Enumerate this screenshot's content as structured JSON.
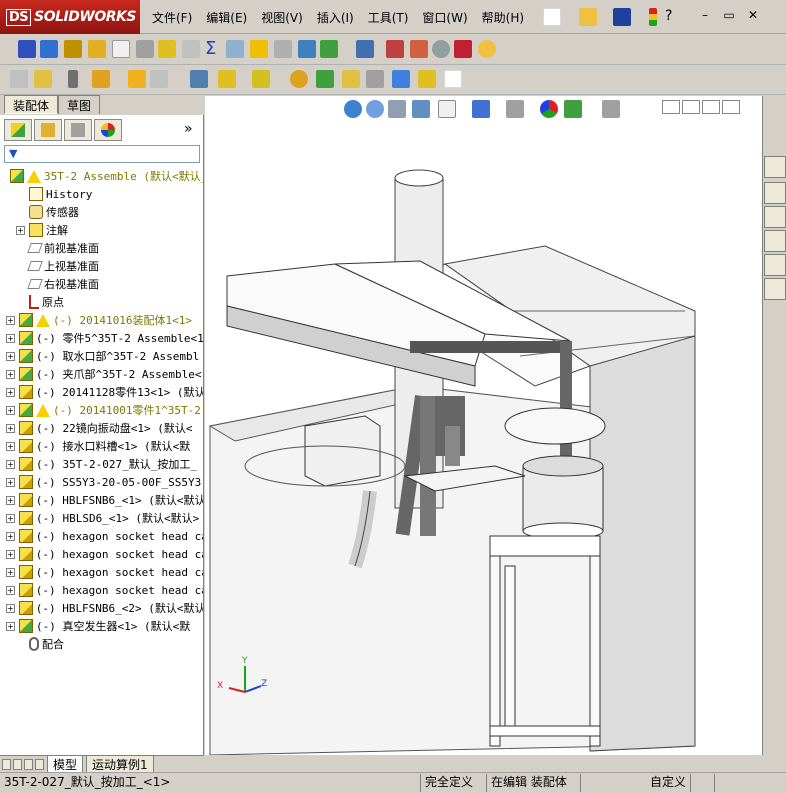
{
  "app": {
    "brand": "SOLIDWORKS",
    "brand_prefix": "DS"
  },
  "menu": [
    "文件(F)",
    "编辑(E)",
    "视图(V)",
    "插入(I)",
    "工具(T)",
    "窗口(W)",
    "帮助(H)"
  ],
  "window_controls": {
    "minimize": "–",
    "restore": "▭",
    "close": "✕"
  },
  "command_tabs": [
    {
      "label": "装配体",
      "active": true
    },
    {
      "label": "草图",
      "active": false
    }
  ],
  "filter": {
    "glyph": "▼"
  },
  "pane_collapse": "»",
  "tree": [
    {
      "label": "35T-2 Assemble  (默认<默认_",
      "icon": "assy",
      "warn": true,
      "exp": false,
      "level": 0,
      "olive": true
    },
    {
      "label": "History",
      "icon": "history",
      "level": 1
    },
    {
      "label": "传感器",
      "icon": "sensor",
      "level": 1
    },
    {
      "label": "注解",
      "icon": "annot",
      "level": 1,
      "exp": true
    },
    {
      "label": "前视基准面",
      "icon": "plane",
      "level": 1
    },
    {
      "label": "上视基准面",
      "icon": "plane",
      "level": 1
    },
    {
      "label": "右视基准面",
      "icon": "plane",
      "level": 1
    },
    {
      "label": "原点",
      "icon": "origin",
      "level": 1
    },
    {
      "label": "(-) 20141016装配体1<1>",
      "icon": "assy",
      "warn": true,
      "exp": true,
      "olive": true
    },
    {
      "label": "(-) 零件5^35T-2 Assemble<1",
      "icon": "assy",
      "exp": true
    },
    {
      "label": "(-) 取水口部^35T-2 Assembl",
      "icon": "assy",
      "exp": true
    },
    {
      "label": "(-) 夹爪部^35T-2 Assemble<",
      "icon": "assy",
      "exp": true
    },
    {
      "label": "(-) 20141128零件13<1> (默认",
      "icon": "part",
      "exp": true
    },
    {
      "label": "(-) 20141001零件1^35T-2",
      "icon": "assy",
      "warn": true,
      "exp": true,
      "olive": true
    },
    {
      "label": "(-) 22镜向振动盘<1> (默认<",
      "icon": "part",
      "exp": true
    },
    {
      "label": "(-) 接水口料槽<1> (默认<默",
      "icon": "part",
      "exp": true
    },
    {
      "label": "(-) 35T-2-027_默认_按加工_",
      "icon": "part",
      "exp": true
    },
    {
      "label": "(-) SS5Y3-20-05-00F_SS5Y3-2",
      "icon": "part",
      "exp": true
    },
    {
      "label": "(-) HBLFSNB6_<1> (默认<默认",
      "icon": "part",
      "exp": true
    },
    {
      "label": "(-) HBLSD6_<1> (默认<默认>",
      "icon": "part",
      "exp": true
    },
    {
      "label": "(-) hexagon socket head cap",
      "icon": "part",
      "exp": true
    },
    {
      "label": "(-) hexagon socket head cap",
      "icon": "part",
      "exp": true
    },
    {
      "label": "(-) hexagon socket head cap",
      "icon": "part",
      "exp": true
    },
    {
      "label": "(-) hexagon socket head cap",
      "icon": "part",
      "exp": true
    },
    {
      "label": "(-) HBLFSNB6_<2> (默认<默认",
      "icon": "part",
      "exp": true
    },
    {
      "label": "(-) 真空发生器<1> (默认<默",
      "icon": "assy",
      "exp": true
    },
    {
      "label": "配合",
      "icon": "mate",
      "level": 1
    }
  ],
  "bottom_tabs": [
    {
      "label": "模型",
      "active": true
    },
    {
      "label": "运动算例1",
      "active": false
    }
  ],
  "triad": {
    "x": "X",
    "y": "Y",
    "z": "Z"
  },
  "status": {
    "selection": "35T-2-027_默认_按加工_<1>",
    "definition": "完全定义",
    "mode": "在编辑 装配体",
    "units": "自定义"
  }
}
